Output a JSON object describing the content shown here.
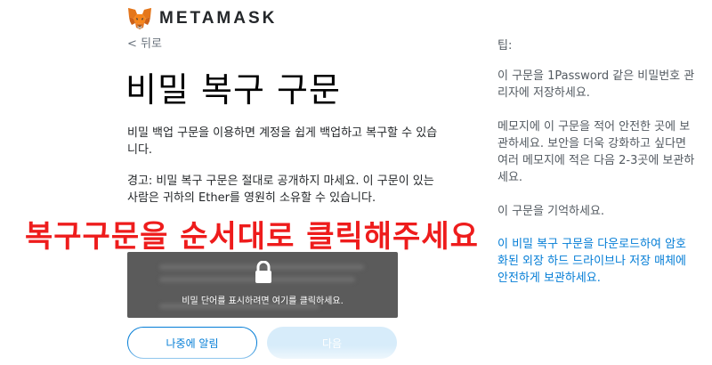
{
  "header": {
    "brand": "METAMASK",
    "logo_icon": "metamask-fox-icon"
  },
  "nav": {
    "back_label": "< 뒤로"
  },
  "main": {
    "title": "비밀 복구 구문",
    "description": "비밀 백업 구문을 이용하면 계정을 쉽게 백업하고 복구할 수 있습니다.",
    "warning": "경고: 비밀 복구 구문은 절대로 공개하지 마세요. 이 구문이 있는 사람은 귀하의 Ether를 영원히 소유할 수 있습니다."
  },
  "overlay": {
    "caption": "복구구문을 순서대로 클릭해주세요"
  },
  "reveal": {
    "icon": "lock-icon",
    "label": "비밀 단어를 표시하려면 여기를 클릭하세요."
  },
  "buttons": {
    "later_label": "나중에 알림",
    "next_label": "다음"
  },
  "tips": {
    "heading": "팁:",
    "items": [
      "이 구문을 1Password 같은 비밀번호 관리자에 저장하세요.",
      "메모지에 이 구문을 적어 안전한 곳에 보관하세요. 보안을 더욱 강화하고 싶다면 여러 메모지에 적은 다음 2-3곳에 보관하세요.",
      "이 구문을 기억하세요.",
      "이 비밀 복구 구문을 다운로드하여 암호화된 외장 하드 드라이브나 저장 매체에 안전하게 보관하세요."
    ]
  },
  "colors": {
    "accent": "#037dd6",
    "caption_red": "#ee1c1c",
    "reveal_bg": "#5b5b5b",
    "next_disabled": "#d7ecfa"
  }
}
